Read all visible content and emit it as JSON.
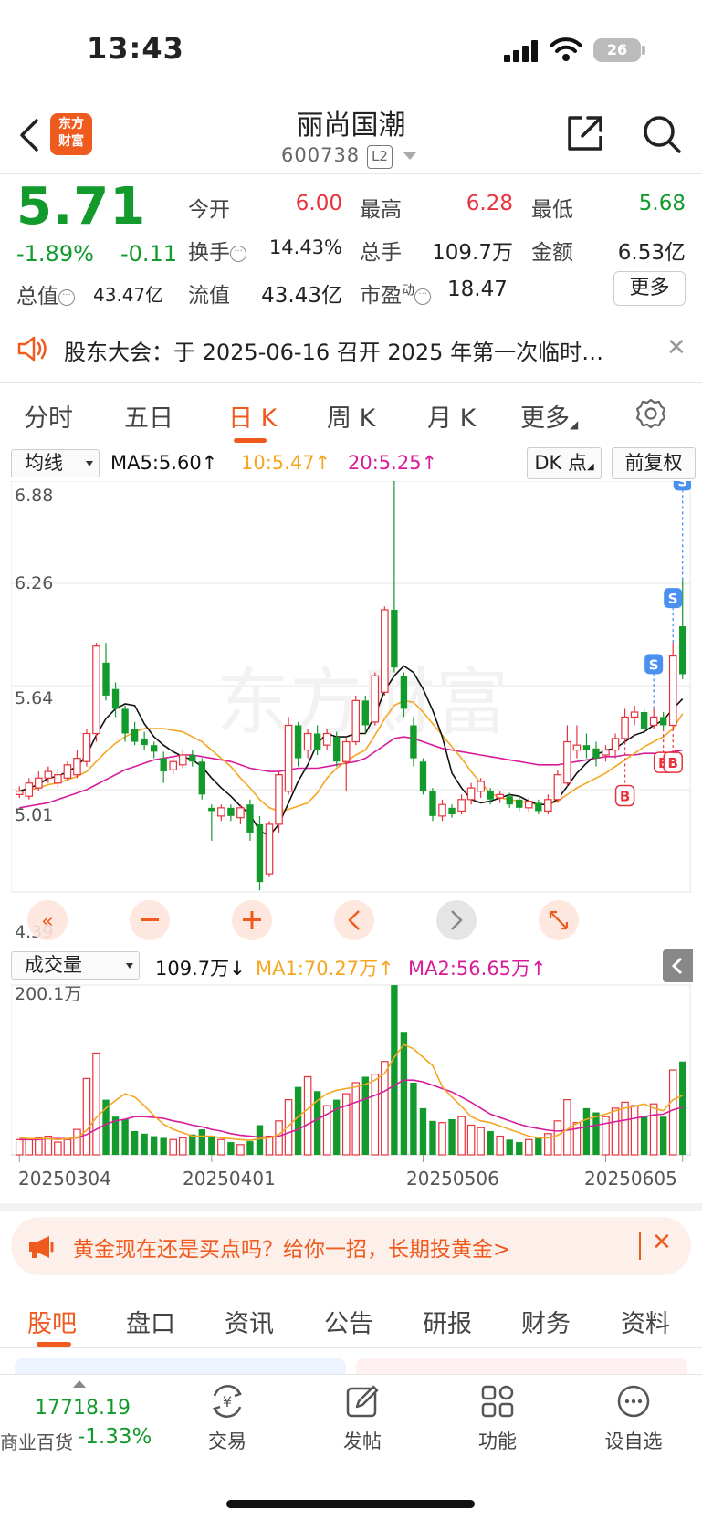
{
  "status_bar": {
    "time": "13:43",
    "battery": "26"
  },
  "header": {
    "logo_line1": "东方",
    "logo_line2": "财富",
    "stock_name": "丽尚国潮",
    "stock_code": "600738",
    "badge": "L2"
  },
  "quote": {
    "price": "5.71",
    "change_pct": "-1.89%",
    "change_amt": "-0.11",
    "total_value_label": "总值",
    "total_value": "43.47亿",
    "open_label": "今开",
    "open": "6.00",
    "high_label": "最高",
    "high": "6.28",
    "low_label": "最低",
    "low": "5.68",
    "turnover_label": "换手",
    "turnover": "14.43%",
    "volume_label": "总手",
    "volume": "109.7万",
    "amount_label": "金额",
    "amount": "6.53亿",
    "float_label": "流值",
    "float_value": "43.43亿",
    "pe_label": "市盈",
    "pe_sup": "动",
    "pe": "18.47",
    "more": "更多"
  },
  "notice": {
    "text": "股东大会：于 2025-06-16 召开 2025 年第一次临时…"
  },
  "period_tabs": [
    "分时",
    "五日",
    "日 K",
    "周 K",
    "月 K",
    "更多"
  ],
  "active_period": "日 K",
  "ma_bar": {
    "select": "均线",
    "ma5": "MA5:5.60↑",
    "ma10": "10:5.47↑",
    "ma20": "20:5.25↑",
    "dk": "DK 点",
    "fq": "前复权"
  },
  "kchart_labels": {
    "top": "6.88",
    "mid1": "6.26",
    "mid2": "5.64",
    "mid3": "5.01",
    "bottom": "4.39"
  },
  "marker_labels": {
    "sell": "S",
    "buy": "B"
  },
  "vol_bar": {
    "select": "成交量",
    "vol": "109.7万↓",
    "ma1": "MA1:70.27万↑",
    "ma2": "MA2:56.65万↑",
    "scale": "200.1万"
  },
  "dates": [
    "20250304",
    "20250401",
    "20250506",
    "20250605"
  ],
  "colors": {
    "up": "#e8323c",
    "down": "#139a2c",
    "ma5": "#111111",
    "ma10": "#f5a623",
    "ma20": "#d81b9a",
    "accent": "#ef5a1f"
  },
  "ad": {
    "text": "黄金现在还是买点吗？给你一招，长期投黄金>"
  },
  "bottom_tabs": [
    "股吧",
    "盘口",
    "资讯",
    "公告",
    "研报",
    "财务",
    "资料"
  ],
  "index": {
    "value": "17718.19",
    "name": "商业百货",
    "pct": "-1.33%"
  },
  "nav": [
    "交易",
    "发帖",
    "功能",
    "设自选"
  ],
  "chart_data": {
    "type": "candlestick",
    "price_axis": [
      4.39,
      5.01,
      5.64,
      6.26,
      6.88
    ],
    "candles": [
      [
        4.98,
        5.0,
        5.03,
        4.96
      ],
      [
        4.97,
        5.05,
        5.08,
        4.95
      ],
      [
        5.02,
        5.08,
        5.12,
        5.0
      ],
      [
        5.08,
        5.12,
        5.15,
        5.05
      ],
      [
        5.05,
        5.1,
        5.14,
        5.02
      ],
      [
        5.08,
        5.16,
        5.18,
        5.06
      ],
      [
        5.1,
        5.2,
        5.25,
        5.08
      ],
      [
        5.18,
        5.35,
        5.38,
        5.15
      ],
      [
        5.35,
        5.88,
        5.9,
        5.3
      ],
      [
        5.78,
        5.58,
        5.9,
        5.55
      ],
      [
        5.62,
        5.5,
        5.66,
        5.45
      ],
      [
        5.5,
        5.35,
        5.52,
        5.3
      ],
      [
        5.38,
        5.3,
        5.42,
        5.28
      ],
      [
        5.32,
        5.28,
        5.36,
        5.25
      ],
      [
        5.28,
        5.24,
        5.3,
        5.2
      ],
      [
        5.2,
        5.12,
        5.24,
        5.05
      ],
      [
        5.13,
        5.18,
        5.2,
        5.1
      ],
      [
        5.16,
        5.22,
        5.25,
        5.14
      ],
      [
        5.22,
        5.18,
        5.25,
        5.15
      ],
      [
        5.18,
        4.98,
        5.2,
        4.95
      ],
      [
        4.9,
        4.88,
        4.92,
        4.7
      ],
      [
        4.85,
        4.9,
        4.92,
        4.82
      ],
      [
        4.9,
        4.85,
        4.92,
        4.82
      ],
      [
        4.84,
        4.9,
        4.92,
        4.8
      ],
      [
        4.92,
        4.75,
        4.95,
        4.7
      ],
      [
        4.8,
        4.45,
        4.85,
        4.4
      ],
      [
        4.5,
        4.8,
        4.82,
        4.48
      ],
      [
        4.8,
        5.1,
        5.12,
        4.75
      ],
      [
        5.0,
        5.4,
        5.45,
        4.98
      ],
      [
        5.4,
        5.2,
        5.42,
        5.15
      ],
      [
        5.25,
        5.35,
        5.38,
        5.2
      ],
      [
        5.35,
        5.25,
        5.4,
        5.22
      ],
      [
        5.28,
        5.35,
        5.38,
        5.25
      ],
      [
        5.33,
        5.18,
        5.36,
        5.15
      ],
      [
        5.18,
        5.3,
        5.33,
        5.0
      ],
      [
        5.3,
        5.55,
        5.58,
        5.28
      ],
      [
        5.55,
        5.4,
        5.58,
        5.35
      ],
      [
        5.42,
        5.7,
        5.72,
        5.4
      ],
      [
        5.6,
        6.1,
        6.12,
        5.58
      ],
      [
        6.1,
        5.75,
        6.88,
        5.72
      ],
      [
        5.7,
        5.5,
        5.72,
        5.45
      ],
      [
        5.4,
        5.2,
        5.45,
        5.15
      ],
      [
        5.18,
        5.0,
        5.2,
        4.98
      ],
      [
        5.0,
        4.85,
        5.02,
        4.82
      ],
      [
        4.85,
        4.92,
        4.95,
        4.82
      ],
      [
        4.9,
        4.86,
        4.92,
        4.84
      ],
      [
        4.88,
        4.95,
        4.98,
        4.86
      ],
      [
        4.95,
        5.02,
        5.05,
        4.92
      ],
      [
        5.0,
        5.06,
        5.08,
        4.96
      ],
      [
        5.0,
        4.95,
        5.02,
        4.92
      ],
      [
        4.96,
        4.98,
        5.0,
        4.93
      ],
      [
        4.97,
        4.92,
        4.99,
        4.9
      ],
      [
        4.95,
        4.9,
        4.97,
        4.88
      ],
      [
        4.9,
        4.94,
        4.96,
        4.87
      ],
      [
        4.93,
        4.88,
        4.95,
        4.86
      ],
      [
        4.88,
        4.95,
        4.98,
        4.86
      ],
      [
        4.95,
        5.1,
        5.13,
        4.93
      ],
      [
        5.05,
        5.3,
        5.4,
        5.03
      ],
      [
        5.25,
        5.28,
        5.4,
        5.2
      ],
      [
        5.28,
        5.25,
        5.35,
        5.2
      ],
      [
        5.26,
        5.2,
        5.3,
        5.15
      ],
      [
        5.22,
        5.25,
        5.28,
        5.18
      ],
      [
        5.25,
        5.32,
        5.35,
        5.2
      ],
      [
        5.32,
        5.45,
        5.5,
        5.3
      ],
      [
        5.45,
        5.48,
        5.52,
        5.4
      ],
      [
        5.48,
        5.38,
        5.5,
        5.35
      ],
      [
        5.4,
        5.45,
        5.5,
        5.38
      ],
      [
        5.45,
        5.4,
        5.48,
        5.38
      ],
      [
        5.4,
        5.82,
        5.9,
        5.38
      ],
      [
        6.0,
        5.71,
        6.28,
        5.68
      ]
    ],
    "buy_sell_markers": [
      {
        "index": 63,
        "type": "B"
      },
      {
        "index": 66,
        "type": "S"
      },
      {
        "index": 67,
        "type": "B"
      },
      {
        "index": 68,
        "type": "B"
      },
      {
        "index": 68,
        "type": "S"
      },
      {
        "index": 69,
        "type": "S"
      }
    ],
    "volume_max_wan": 200.1,
    "volumes_wan": [
      18,
      18,
      20,
      22,
      15,
      18,
      30,
      90,
      120,
      65,
      45,
      42,
      28,
      25,
      22,
      20,
      18,
      20,
      24,
      30,
      22,
      18,
      15,
      12,
      16,
      35,
      22,
      40,
      65,
      80,
      92,
      75,
      58,
      65,
      72,
      85,
      92,
      95,
      110,
      200,
      145,
      85,
      55,
      40,
      38,
      42,
      45,
      35,
      32,
      28,
      22,
      18,
      15,
      18,
      20,
      25,
      40,
      65,
      38,
      55,
      50,
      45,
      55,
      62,
      58,
      45,
      60,
      45,
      100,
      110
    ],
    "series": [
      {
        "name": "MA5",
        "values": [
          5.0,
          5.02,
          5.04,
          5.08,
          5.09,
          5.12,
          5.15,
          5.22,
          5.34,
          5.44,
          5.5,
          5.53,
          5.52,
          5.41,
          5.33,
          5.28,
          5.24,
          5.21,
          5.19,
          5.15,
          5.08,
          5.02,
          4.97,
          4.91,
          4.86,
          4.76,
          4.73,
          4.8,
          4.93,
          5.06,
          5.16,
          5.29,
          5.35,
          5.33,
          5.33,
          5.35,
          5.35,
          5.46,
          5.61,
          5.7,
          5.76,
          5.72,
          5.62,
          5.49,
          5.33,
          5.11,
          5.02,
          4.95,
          4.93,
          4.94,
          4.96,
          4.98,
          4.97,
          4.94,
          4.92,
          4.92,
          4.95,
          5.03,
          5.11,
          5.17,
          5.22,
          5.25,
          5.26,
          5.3,
          5.34,
          5.36,
          5.4,
          5.43,
          5.5,
          5.56
        ]
      },
      {
        "name": "MA10",
        "values": [
          5.0,
          5.01,
          5.02,
          5.04,
          5.05,
          5.07,
          5.09,
          5.12,
          5.18,
          5.24,
          5.29,
          5.33,
          5.36,
          5.38,
          5.38,
          5.38,
          5.37,
          5.36,
          5.33,
          5.3,
          5.25,
          5.2,
          5.15,
          5.08,
          5.02,
          4.95,
          4.9,
          4.88,
          4.89,
          4.91,
          4.93,
          4.99,
          5.08,
          5.14,
          5.18,
          5.22,
          5.25,
          5.34,
          5.44,
          5.52,
          5.55,
          5.54,
          5.48,
          5.41,
          5.34,
          5.27,
          5.2,
          5.12,
          5.05,
          4.99,
          4.96,
          4.95,
          4.94,
          4.93,
          4.92,
          4.92,
          4.94,
          4.98,
          5.02,
          5.05,
          5.08,
          5.11,
          5.15,
          5.19,
          5.23,
          5.27,
          5.3,
          5.33,
          5.38,
          5.47
        ]
      },
      {
        "name": "MA20",
        "values": [
          4.9,
          4.91,
          4.92,
          4.93,
          4.95,
          4.97,
          4.99,
          5.01,
          5.04,
          5.07,
          5.1,
          5.13,
          5.15,
          5.17,
          5.19,
          5.2,
          5.21,
          5.22,
          5.22,
          5.21,
          5.2,
          5.19,
          5.18,
          5.16,
          5.14,
          5.13,
          5.12,
          5.12,
          5.13,
          5.14,
          5.14,
          5.14,
          5.15,
          5.16,
          5.17,
          5.18,
          5.2,
          5.24,
          5.28,
          5.32,
          5.33,
          5.32,
          5.3,
          5.28,
          5.26,
          5.25,
          5.24,
          5.23,
          5.22,
          5.21,
          5.2,
          5.19,
          5.18,
          5.17,
          5.16,
          5.16,
          5.16,
          5.17,
          5.18,
          5.19,
          5.2,
          5.21,
          5.21,
          5.22,
          5.22,
          5.23,
          5.23,
          5.23,
          5.24,
          5.25
        ]
      }
    ],
    "volume_ma": [
      {
        "name": "MA1",
        "values": [
          20,
          19,
          19,
          19,
          18,
          19,
          20,
          29,
          44,
          55,
          64,
          72,
          68,
          58,
          46,
          36,
          30,
          26,
          22,
          22,
          22,
          20,
          19,
          18,
          17,
          19,
          20,
          24,
          34,
          45,
          54,
          64,
          72,
          76,
          78,
          80,
          83,
          88,
          96,
          115,
          130,
          125,
          115,
          105,
          80,
          68,
          57,
          45,
          40,
          38,
          34,
          30,
          26,
          22,
          20,
          20,
          23,
          30,
          37,
          42,
          45,
          48,
          52,
          55,
          57,
          60,
          55,
          52,
          65,
          70
        ]
      },
      {
        "name": "MA2",
        "values": [
          18,
          18,
          18,
          19,
          19,
          19,
          20,
          24,
          30,
          36,
          40,
          42,
          45,
          45,
          44,
          43,
          40,
          38,
          35,
          33,
          30,
          28,
          25,
          23,
          22,
          21,
          21,
          22,
          26,
          30,
          36,
          42,
          48,
          54,
          58,
          62,
          66,
          70,
          75,
          82,
          88,
          88,
          86,
          82,
          78,
          74,
          68,
          62,
          55,
          48,
          44,
          40,
          36,
          33,
          31,
          29,
          28,
          29,
          31,
          33,
          35,
          37,
          39,
          41,
          43,
          45,
          47,
          48,
          53,
          56
        ]
      }
    ]
  }
}
